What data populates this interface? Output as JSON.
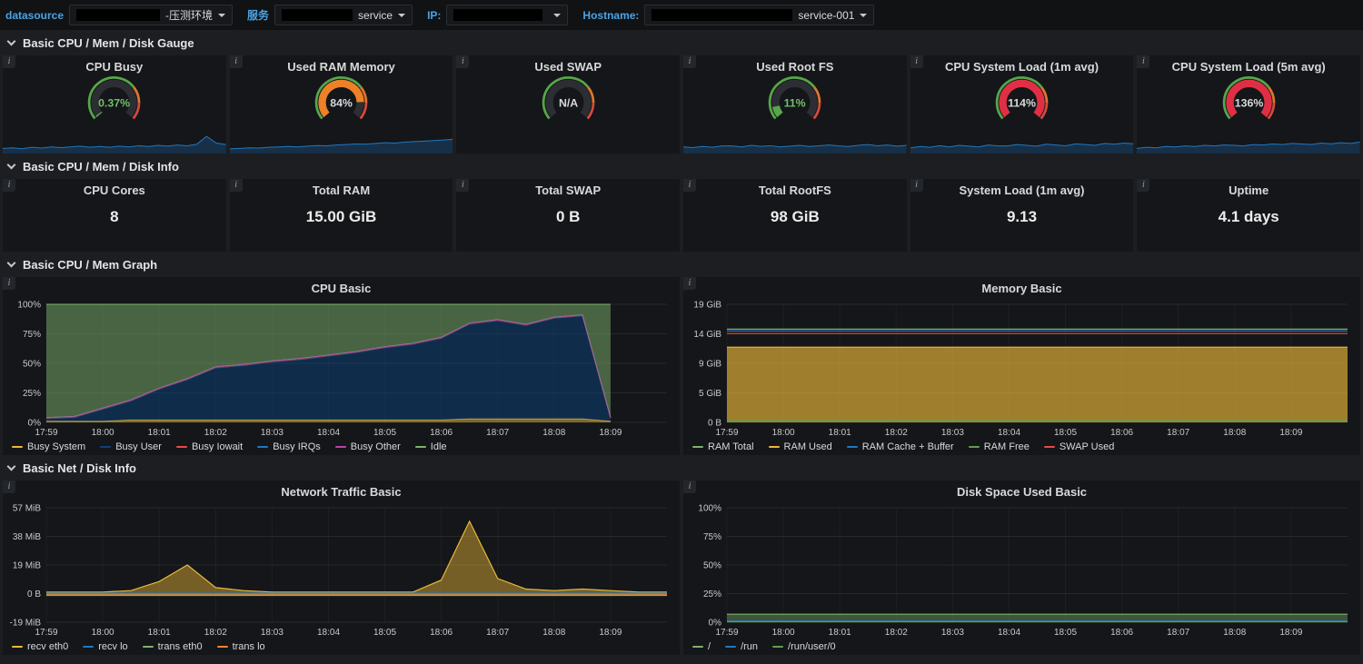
{
  "colors": {
    "accent_blue": "#4ba3e3",
    "sparkline": "#1f78c1",
    "gauge_green": "#56a64b",
    "gauge_orange": "#ED8128",
    "gauge_red": "#d44a3a"
  },
  "topbar": {
    "filters": [
      {
        "label": "datasource",
        "value": "-压测环境",
        "redacted": true
      },
      {
        "label": "服务",
        "value": "service",
        "redacted": true
      },
      {
        "label": "IP:",
        "value": "",
        "redacted": true
      },
      {
        "label": "Hostname:",
        "value": "service-001",
        "redacted": true
      }
    ]
  },
  "rows": [
    {
      "title": "Basic CPU / Mem / Disk Gauge"
    },
    {
      "title": "Basic CPU / Mem / Disk Info"
    },
    {
      "title": "Basic CPU / Mem Graph"
    },
    {
      "title": "Basic Net / Disk Info"
    }
  ],
  "gauge_thresholds": [
    [
      0,
      70,
      "#56a64b"
    ],
    [
      70,
      85,
      "#e0752d"
    ],
    [
      85,
      100,
      "#d44a3a"
    ]
  ],
  "gauges": [
    {
      "title": "CPU Busy",
      "value": "0.37%",
      "pct": 0.37,
      "color": "#56a64b",
      "text_color": "#73bf69",
      "spark": [
        0.22,
        0.25,
        0.2,
        0.28,
        0.24,
        0.3,
        0.26,
        0.3,
        0.34,
        0.28,
        0.32,
        0.28,
        0.34,
        0.3,
        0.36,
        0.32,
        0.38,
        0.34,
        0.4,
        0.36,
        0.44,
        0.85,
        0.5,
        0.42
      ]
    },
    {
      "title": "Used RAM Memory",
      "value": "84%",
      "pct": 84,
      "color": "#ED8128",
      "text_color": "#d8d9da",
      "spark": [
        0.2,
        0.22,
        0.25,
        0.24,
        0.28,
        0.3,
        0.32,
        0.3,
        0.34,
        0.37,
        0.36,
        0.4,
        0.42,
        0.45,
        0.44,
        0.48,
        0.52,
        0.5,
        0.55,
        0.58,
        0.6,
        0.63,
        0.66,
        0.7
      ]
    },
    {
      "title": "Used SWAP",
      "value": "N/A",
      "pct": null,
      "color": "#56a64b",
      "text_color": "#d8d9da",
      "spark": []
    },
    {
      "title": "Used Root FS",
      "value": "11%",
      "pct": 11,
      "color": "#56a64b",
      "text_color": "#73bf69",
      "spark": [
        0.3,
        0.26,
        0.32,
        0.28,
        0.35,
        0.35,
        0.3,
        0.38,
        0.33,
        0.36,
        0.3,
        0.34,
        0.38,
        0.32,
        0.36,
        0.4,
        0.35,
        0.32,
        0.38,
        0.42,
        0.36,
        0.4,
        0.34,
        0.38
      ]
    },
    {
      "title": "CPU System Load (1m avg)",
      "value": "114%",
      "pct": 100,
      "color": "#e02f44",
      "text_color": "#d8d9da",
      "spark": [
        0.25,
        0.32,
        0.28,
        0.36,
        0.3,
        0.38,
        0.34,
        0.3,
        0.4,
        0.35,
        0.35,
        0.42,
        0.38,
        0.34,
        0.44,
        0.4,
        0.36,
        0.46,
        0.42,
        0.38,
        0.48,
        0.44,
        0.5,
        0.46
      ]
    },
    {
      "title": "CPU System Load (5m avg)",
      "value": "136%",
      "pct": 100,
      "color": "#e02f44",
      "text_color": "#d8d9da",
      "spark": [
        0.22,
        0.28,
        0.25,
        0.32,
        0.3,
        0.35,
        0.32,
        0.38,
        0.35,
        0.4,
        0.38,
        0.35,
        0.42,
        0.4,
        0.45,
        0.42,
        0.48,
        0.45,
        0.42,
        0.5,
        0.46,
        0.52,
        0.48,
        0.55
      ]
    }
  ],
  "stats": [
    {
      "title": "CPU Cores",
      "value": "8"
    },
    {
      "title": "Total RAM",
      "value": "15.00 GiB"
    },
    {
      "title": "Total SWAP",
      "value": "0 B"
    },
    {
      "title": "Total RootFS",
      "value": "98 GiB"
    },
    {
      "title": "System Load (1m avg)",
      "value": "9.13"
    },
    {
      "title": "Uptime",
      "value": "4.1 days"
    }
  ],
  "chart_data": [
    {
      "id": "cpu-basic",
      "type": "area",
      "title": "CPU Basic",
      "stacked": true,
      "fill_opacity": 0.5,
      "ylim": [
        0,
        100
      ],
      "slots": 23,
      "yticks": [
        {
          "v": 0,
          "label": "0%"
        },
        {
          "v": 25,
          "label": "25%"
        },
        {
          "v": 50,
          "label": "50%"
        },
        {
          "v": 75,
          "label": "75%"
        },
        {
          "v": 100,
          "label": "100%"
        }
      ],
      "xticks": [
        {
          "i": 0,
          "label": "17:59"
        },
        {
          "i": 2,
          "label": "18:00"
        },
        {
          "i": 4,
          "label": "18:01"
        },
        {
          "i": 6,
          "label": "18:02"
        },
        {
          "i": 8,
          "label": "18:03"
        },
        {
          "i": 10,
          "label": "18:04"
        },
        {
          "i": 12,
          "label": "18:05"
        },
        {
          "i": 14,
          "label": "18:06"
        },
        {
          "i": 16,
          "label": "18:07"
        },
        {
          "i": 18,
          "label": "18:08"
        },
        {
          "i": 20,
          "label": "18:09"
        }
      ],
      "series": [
        {
          "name": "Busy System",
          "color": "#EAB839",
          "values": [
            1,
            1,
            1,
            2,
            2,
            2,
            2,
            2,
            2,
            2,
            2,
            2,
            2,
            2,
            2,
            3,
            3,
            3,
            3,
            3,
            1
          ]
        },
        {
          "name": "Busy User",
          "color": "#0A437C",
          "values": [
            2,
            3,
            10,
            16,
            26,
            34,
            44,
            46,
            49,
            51,
            54,
            57,
            61,
            64,
            69,
            80,
            83,
            79,
            85,
            87,
            3
          ]
        },
        {
          "name": "Busy Iowait",
          "color": "#E24D42",
          "values": [
            1,
            1,
            1,
            1,
            1,
            1,
            1,
            1,
            1,
            1,
            1,
            1,
            1,
            1,
            1,
            1,
            1,
            1,
            1,
            1,
            0
          ]
        },
        {
          "name": "Busy IRQs",
          "color": "#1F78C1",
          "values": [
            0,
            0,
            0,
            0,
            0,
            0,
            0,
            0,
            0,
            0,
            0,
            0,
            0,
            0,
            0,
            0,
            0,
            0,
            0,
            0,
            0
          ]
        },
        {
          "name": "Busy Other",
          "color": "#BA43A9",
          "values": [
            0,
            0,
            0,
            0,
            0,
            0,
            0,
            0,
            0,
            0,
            0,
            0,
            0,
            0,
            0,
            0,
            0,
            0,
            0,
            0,
            0
          ]
        },
        {
          "name": "Idle",
          "color": "#7EB26D",
          "values": [
            96,
            95,
            88,
            81,
            71,
            63,
            53,
            51,
            48,
            46,
            43,
            40,
            36,
            33,
            28,
            16,
            13,
            17,
            11,
            9,
            96
          ]
        }
      ]
    },
    {
      "id": "memory-basic",
      "type": "line",
      "title": "Memory Basic",
      "stacked": false,
      "fill_opacity": 0.65,
      "ylim": [
        0,
        19
      ],
      "slots": 23,
      "points": 23,
      "yticks": [
        {
          "v": 0,
          "label": "0 B"
        },
        {
          "v": 4.75,
          "label": "5 GiB"
        },
        {
          "v": 9.5,
          "label": "9 GiB"
        },
        {
          "v": 14.25,
          "label": "14 GiB"
        },
        {
          "v": 19,
          "label": "19 GiB"
        }
      ],
      "xticks": [
        {
          "i": 0,
          "label": "17:59"
        },
        {
          "i": 2,
          "label": "18:00"
        },
        {
          "i": 4,
          "label": "18:01"
        },
        {
          "i": 6,
          "label": "18:02"
        },
        {
          "i": 8,
          "label": "18:03"
        },
        {
          "i": 10,
          "label": "18:04"
        },
        {
          "i": 12,
          "label": "18:05"
        },
        {
          "i": 14,
          "label": "18:06"
        },
        {
          "i": 16,
          "label": "18:07"
        },
        {
          "i": 18,
          "label": "18:08"
        },
        {
          "i": 20,
          "label": "18:09"
        }
      ],
      "series": [
        {
          "name": "RAM Total",
          "color": "#7EB26D",
          "flat": 15.0
        },
        {
          "name": "RAM Used",
          "color": "#EAB839",
          "flat": 12.1,
          "fill": true
        },
        {
          "name": "RAM Cache + Buffer",
          "color": "#1F78C1",
          "flat": 14.7
        },
        {
          "name": "RAM Free",
          "color": "#629E51",
          "flat": 0.35
        },
        {
          "name": "SWAP Used",
          "color": "#E24D42",
          "flat": 14.3
        }
      ]
    },
    {
      "id": "network-traffic-basic",
      "type": "area",
      "title": "Network Traffic Basic",
      "stacked": false,
      "fill_opacity": 0.45,
      "ylim": [
        -19,
        57
      ],
      "slots": 23,
      "points": 23,
      "yticks": [
        {
          "v": -19,
          "label": "-19 MiB"
        },
        {
          "v": 0,
          "label": "0 B"
        },
        {
          "v": 19,
          "label": "19 MiB"
        },
        {
          "v": 38,
          "label": "38 MiB"
        },
        {
          "v": 57,
          "label": "57 MiB"
        }
      ],
      "xticks": [
        {
          "i": 0,
          "label": "17:59"
        },
        {
          "i": 2,
          "label": "18:00"
        },
        {
          "i": 4,
          "label": "18:01"
        },
        {
          "i": 6,
          "label": "18:02"
        },
        {
          "i": 8,
          "label": "18:03"
        },
        {
          "i": 10,
          "label": "18:04"
        },
        {
          "i": 12,
          "label": "18:05"
        },
        {
          "i": 14,
          "label": "18:06"
        },
        {
          "i": 16,
          "label": "18:07"
        },
        {
          "i": 18,
          "label": "18:08"
        },
        {
          "i": 20,
          "label": "18:09"
        }
      ],
      "series": [
        {
          "name": "recv eth0",
          "color": "#EAB839",
          "fill": true,
          "values": [
            1,
            1,
            1,
            2,
            8,
            19,
            4,
            2,
            1,
            1,
            1,
            1,
            1,
            1,
            9,
            48,
            10,
            3,
            2,
            3,
            2,
            1,
            1
          ]
        },
        {
          "name": "recv lo",
          "color": "#1F78C1",
          "flat": 0.3
        },
        {
          "name": "trans eth0",
          "color": "#7EB26D",
          "fill": true,
          "flat": -1.2
        },
        {
          "name": "trans lo",
          "color": "#EF843C",
          "flat": -0.4
        }
      ]
    },
    {
      "id": "disk-space-used-basic",
      "type": "area",
      "title": "Disk Space Used Basic",
      "stacked": false,
      "fill_opacity": 0.4,
      "ylim": [
        0,
        100
      ],
      "slots": 23,
      "points": 23,
      "yticks": [
        {
          "v": 0,
          "label": "0%"
        },
        {
          "v": 25,
          "label": "25%"
        },
        {
          "v": 50,
          "label": "50%"
        },
        {
          "v": 75,
          "label": "75%"
        },
        {
          "v": 100,
          "label": "100%"
        }
      ],
      "xticks": [
        {
          "i": 0,
          "label": "17:59"
        },
        {
          "i": 2,
          "label": "18:00"
        },
        {
          "i": 4,
          "label": "18:01"
        },
        {
          "i": 6,
          "label": "18:02"
        },
        {
          "i": 8,
          "label": "18:03"
        },
        {
          "i": 10,
          "label": "18:04"
        },
        {
          "i": 12,
          "label": "18:05"
        },
        {
          "i": 14,
          "label": "18:06"
        },
        {
          "i": 16,
          "label": "18:07"
        },
        {
          "i": 18,
          "label": "18:08"
        },
        {
          "i": 20,
          "label": "18:09"
        }
      ],
      "series": [
        {
          "name": "/",
          "color": "#7EB26D",
          "fill": true,
          "flat": 7
        },
        {
          "name": "/run",
          "color": "#1F78C1",
          "flat": 1
        },
        {
          "name": "/run/user/0",
          "color": "#629E51",
          "flat": 0.4
        }
      ]
    }
  ]
}
